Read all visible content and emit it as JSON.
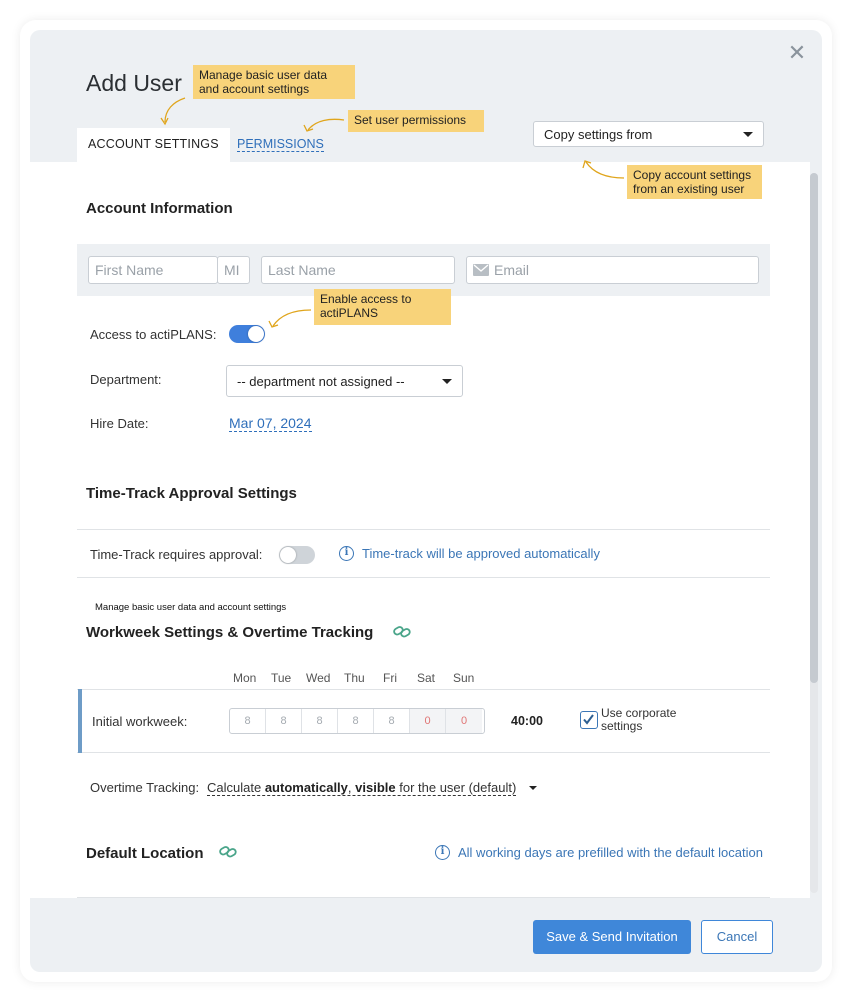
{
  "dialog": {
    "title": "Add User",
    "close_glyph": "✕"
  },
  "tabs": [
    {
      "label": "ACCOUNT SETTINGS",
      "active": true
    },
    {
      "label": "PERMISSIONS",
      "active": false
    }
  ],
  "copy_settings": {
    "value": "Copy settings from"
  },
  "tooltips": {
    "title": "Manage basic user data and account settings",
    "permissions": "Set user permissions",
    "copy": "Copy account settings from an existing user",
    "actiplans": "Enable access to actiPLANS",
    "workweek": "Manage basic user data and account settings"
  },
  "account_info": {
    "title": "Account Information",
    "first_name_placeholder": "First Name",
    "mi_placeholder": "MI",
    "last_name_placeholder": "Last Name",
    "email_placeholder": "Email",
    "access_label": "Access to actiPLANS:",
    "access_on": true,
    "department_label": "Department:",
    "department_value": "-- department not assigned --",
    "hire_date_label": "Hire Date:",
    "hire_date_value": "Mar 07, 2024"
  },
  "approval": {
    "title": "Time-Track Approval Settings",
    "requires_label": "Time-Track requires approval:",
    "requires_on": false,
    "info": "Time-track will be approved automatically"
  },
  "workweek": {
    "title": "Workweek Settings & Overtime Tracking",
    "days": [
      "Mon",
      "Tue",
      "Wed",
      "Thu",
      "Fri",
      "Sat",
      "Sun"
    ],
    "row_label": "Initial workweek:",
    "hours": [
      "8",
      "8",
      "8",
      "8",
      "8",
      "0",
      "0"
    ],
    "total": "40:00",
    "corporate_label": "Use corporate settings",
    "corporate_checked": true
  },
  "overtime": {
    "label": "Overtime Tracking:",
    "value_prefix": "Calculate ",
    "value_bold1": "automatically",
    "value_sep": ", ",
    "value_bold2": "visible",
    "value_suffix": " for the user (default)"
  },
  "location": {
    "title": "Default Location",
    "info": "All working days are prefilled with the default location"
  },
  "footer": {
    "save": "Save & Send Invitation",
    "cancel": "Cancel"
  },
  "colors": {
    "accent": "#3f87d9",
    "tooltip": "#f8d37a",
    "link": "#2f6fba"
  }
}
